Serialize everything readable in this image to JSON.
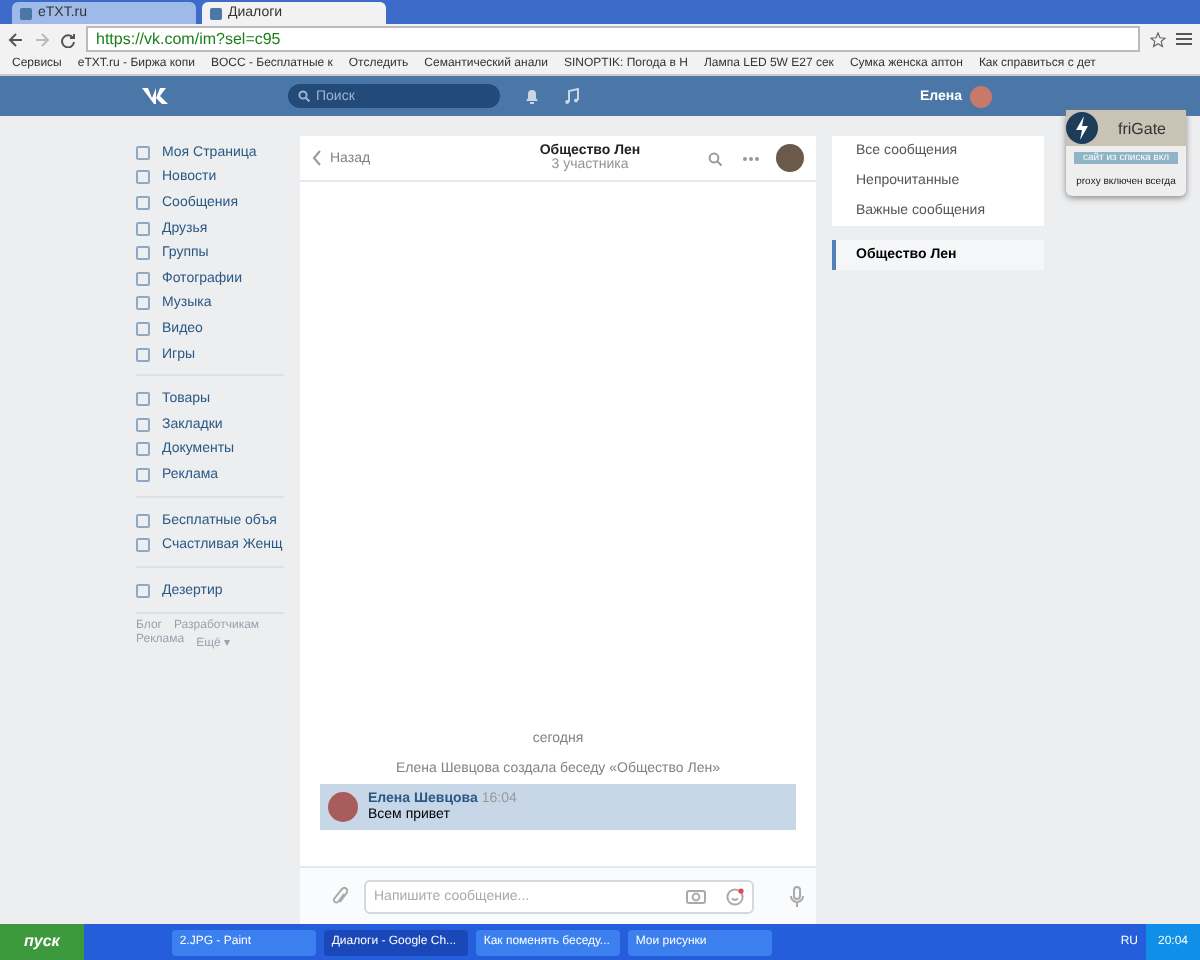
{
  "browser": {
    "tabs": [
      {
        "title": "eTXT.ru",
        "selected": false
      },
      {
        "title": "Диалоги",
        "selected": true
      }
    ],
    "url": "https://vk.com/im?sel=c95",
    "bookmarks": [
      "Сервисы",
      "eTXT.ru - Биржа копи",
      "BOCC - Бесплатные к",
      "Отследить",
      "Семантический анали",
      "SINOPTIK: Погода в Н",
      "Лампа LED 5W E27 сек",
      "Сумка женска аптон",
      "Как справиться с дет"
    ]
  },
  "header": {
    "search": {
      "placeholder": "Поиск"
    },
    "user": "Елена"
  },
  "menu_groups": [
    [
      "Моя Страница",
      "Новости",
      "Сообщения",
      "Друзья",
      "Группы",
      "Фотографии",
      "Музыка",
      "Видео",
      "Игры"
    ],
    [
      "Товары",
      "Закладки",
      "Документы",
      "Реклама"
    ],
    [
      "Бесплатные объя",
      "Счастливая Женщ"
    ],
    [
      "Дезертир"
    ]
  ],
  "footer_links": [
    "Блог",
    "Разработчикам",
    "Реклама",
    "Ещё ▾"
  ],
  "chat": {
    "back": "Назад",
    "title": "Общество Лен",
    "subtitle": "3 участника",
    "date": "сегодня",
    "service_message": "Елена Шевцова создала беседу «Общество Лен»",
    "messages": [
      {
        "author": "Елена Шевцова",
        "time": "16:04",
        "text": "Всем привет",
        "selected": true
      }
    ],
    "input": {
      "placeholder": "Напишите сообщение..."
    }
  },
  "filters": [
    {
      "label": "Все сообщения",
      "selected": false
    },
    {
      "label": "Непрочитанные",
      "selected": false
    },
    {
      "label": "Важные сообщения",
      "selected": false
    },
    {
      "label": "Общество Лен",
      "selected": true
    }
  ],
  "frigate": {
    "title": "friGate",
    "status": "сайт из списка вкл",
    "proxy": "proxy включен всегда"
  },
  "taskbar": {
    "start": "пуск",
    "windows": [
      {
        "title": "2.JPG - Paint",
        "selected": false
      },
      {
        "title": "Диалоги - Google Ch...",
        "selected": true
      },
      {
        "title": "Как поменять беседу...",
        "selected": false
      },
      {
        "title": "Мои рисунки",
        "selected": false
      }
    ],
    "lang": "RU",
    "clock": "20:04"
  }
}
